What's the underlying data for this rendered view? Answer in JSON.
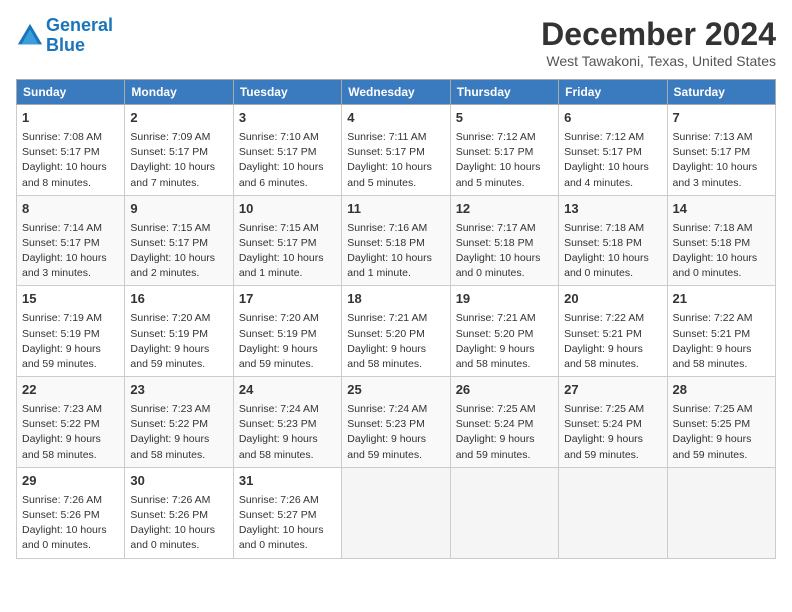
{
  "header": {
    "logo_line1": "General",
    "logo_line2": "Blue",
    "month_title": "December 2024",
    "location": "West Tawakoni, Texas, United States"
  },
  "weekdays": [
    "Sunday",
    "Monday",
    "Tuesday",
    "Wednesday",
    "Thursday",
    "Friday",
    "Saturday"
  ],
  "weeks": [
    [
      {
        "day": "1",
        "lines": [
          "Sunrise: 7:08 AM",
          "Sunset: 5:17 PM",
          "Daylight: 10 hours",
          "and 8 minutes."
        ]
      },
      {
        "day": "2",
        "lines": [
          "Sunrise: 7:09 AM",
          "Sunset: 5:17 PM",
          "Daylight: 10 hours",
          "and 7 minutes."
        ]
      },
      {
        "day": "3",
        "lines": [
          "Sunrise: 7:10 AM",
          "Sunset: 5:17 PM",
          "Daylight: 10 hours",
          "and 6 minutes."
        ]
      },
      {
        "day": "4",
        "lines": [
          "Sunrise: 7:11 AM",
          "Sunset: 5:17 PM",
          "Daylight: 10 hours",
          "and 5 minutes."
        ]
      },
      {
        "day": "5",
        "lines": [
          "Sunrise: 7:12 AM",
          "Sunset: 5:17 PM",
          "Daylight: 10 hours",
          "and 5 minutes."
        ]
      },
      {
        "day": "6",
        "lines": [
          "Sunrise: 7:12 AM",
          "Sunset: 5:17 PM",
          "Daylight: 10 hours",
          "and 4 minutes."
        ]
      },
      {
        "day": "7",
        "lines": [
          "Sunrise: 7:13 AM",
          "Sunset: 5:17 PM",
          "Daylight: 10 hours",
          "and 3 minutes."
        ]
      }
    ],
    [
      {
        "day": "8",
        "lines": [
          "Sunrise: 7:14 AM",
          "Sunset: 5:17 PM",
          "Daylight: 10 hours",
          "and 3 minutes."
        ]
      },
      {
        "day": "9",
        "lines": [
          "Sunrise: 7:15 AM",
          "Sunset: 5:17 PM",
          "Daylight: 10 hours",
          "and 2 minutes."
        ]
      },
      {
        "day": "10",
        "lines": [
          "Sunrise: 7:15 AM",
          "Sunset: 5:17 PM",
          "Daylight: 10 hours",
          "and 1 minute."
        ]
      },
      {
        "day": "11",
        "lines": [
          "Sunrise: 7:16 AM",
          "Sunset: 5:18 PM",
          "Daylight: 10 hours",
          "and 1 minute."
        ]
      },
      {
        "day": "12",
        "lines": [
          "Sunrise: 7:17 AM",
          "Sunset: 5:18 PM",
          "Daylight: 10 hours",
          "and 0 minutes."
        ]
      },
      {
        "day": "13",
        "lines": [
          "Sunrise: 7:18 AM",
          "Sunset: 5:18 PM",
          "Daylight: 10 hours",
          "and 0 minutes."
        ]
      },
      {
        "day": "14",
        "lines": [
          "Sunrise: 7:18 AM",
          "Sunset: 5:18 PM",
          "Daylight: 10 hours",
          "and 0 minutes."
        ]
      }
    ],
    [
      {
        "day": "15",
        "lines": [
          "Sunrise: 7:19 AM",
          "Sunset: 5:19 PM",
          "Daylight: 9 hours",
          "and 59 minutes."
        ]
      },
      {
        "day": "16",
        "lines": [
          "Sunrise: 7:20 AM",
          "Sunset: 5:19 PM",
          "Daylight: 9 hours",
          "and 59 minutes."
        ]
      },
      {
        "day": "17",
        "lines": [
          "Sunrise: 7:20 AM",
          "Sunset: 5:19 PM",
          "Daylight: 9 hours",
          "and 59 minutes."
        ]
      },
      {
        "day": "18",
        "lines": [
          "Sunrise: 7:21 AM",
          "Sunset: 5:20 PM",
          "Daylight: 9 hours",
          "and 58 minutes."
        ]
      },
      {
        "day": "19",
        "lines": [
          "Sunrise: 7:21 AM",
          "Sunset: 5:20 PM",
          "Daylight: 9 hours",
          "and 58 minutes."
        ]
      },
      {
        "day": "20",
        "lines": [
          "Sunrise: 7:22 AM",
          "Sunset: 5:21 PM",
          "Daylight: 9 hours",
          "and 58 minutes."
        ]
      },
      {
        "day": "21",
        "lines": [
          "Sunrise: 7:22 AM",
          "Sunset: 5:21 PM",
          "Daylight: 9 hours",
          "and 58 minutes."
        ]
      }
    ],
    [
      {
        "day": "22",
        "lines": [
          "Sunrise: 7:23 AM",
          "Sunset: 5:22 PM",
          "Daylight: 9 hours",
          "and 58 minutes."
        ]
      },
      {
        "day": "23",
        "lines": [
          "Sunrise: 7:23 AM",
          "Sunset: 5:22 PM",
          "Daylight: 9 hours",
          "and 58 minutes."
        ]
      },
      {
        "day": "24",
        "lines": [
          "Sunrise: 7:24 AM",
          "Sunset: 5:23 PM",
          "Daylight: 9 hours",
          "and 58 minutes."
        ]
      },
      {
        "day": "25",
        "lines": [
          "Sunrise: 7:24 AM",
          "Sunset: 5:23 PM",
          "Daylight: 9 hours",
          "and 59 minutes."
        ]
      },
      {
        "day": "26",
        "lines": [
          "Sunrise: 7:25 AM",
          "Sunset: 5:24 PM",
          "Daylight: 9 hours",
          "and 59 minutes."
        ]
      },
      {
        "day": "27",
        "lines": [
          "Sunrise: 7:25 AM",
          "Sunset: 5:24 PM",
          "Daylight: 9 hours",
          "and 59 minutes."
        ]
      },
      {
        "day": "28",
        "lines": [
          "Sunrise: 7:25 AM",
          "Sunset: 5:25 PM",
          "Daylight: 9 hours",
          "and 59 minutes."
        ]
      }
    ],
    [
      {
        "day": "29",
        "lines": [
          "Sunrise: 7:26 AM",
          "Sunset: 5:26 PM",
          "Daylight: 10 hours",
          "and 0 minutes."
        ]
      },
      {
        "day": "30",
        "lines": [
          "Sunrise: 7:26 AM",
          "Sunset: 5:26 PM",
          "Daylight: 10 hours",
          "and 0 minutes."
        ]
      },
      {
        "day": "31",
        "lines": [
          "Sunrise: 7:26 AM",
          "Sunset: 5:27 PM",
          "Daylight: 10 hours",
          "and 0 minutes."
        ]
      },
      null,
      null,
      null,
      null
    ]
  ]
}
